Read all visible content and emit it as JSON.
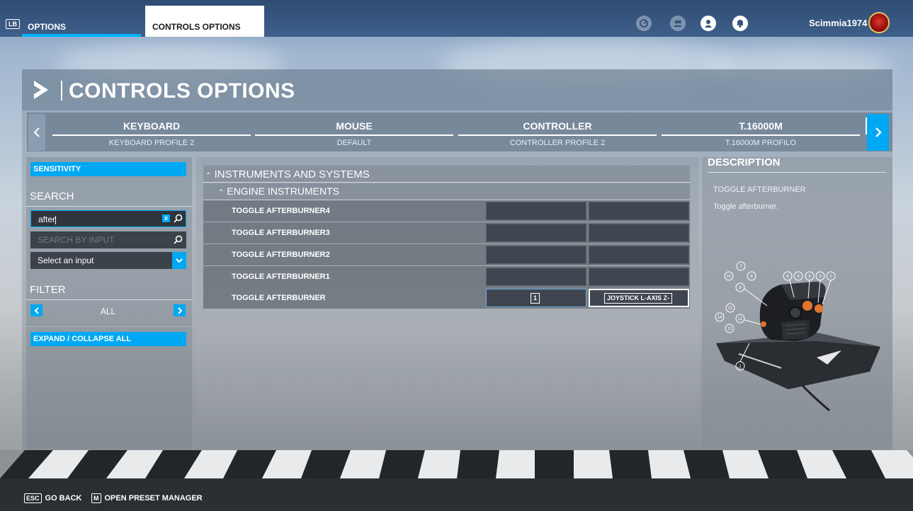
{
  "topbar": {
    "lb_key": "LB",
    "tabs": [
      {
        "label": "OPTIONS"
      },
      {
        "label": "CONTROLS OPTIONS"
      }
    ],
    "username": "Scimmia1974"
  },
  "page": {
    "title": "CONTROLS OPTIONS"
  },
  "devices": [
    {
      "name": "KEYBOARD",
      "profile": "KEYBOARD PROFILE 2"
    },
    {
      "name": "MOUSE",
      "profile": "DEFAULT"
    },
    {
      "name": "CONTROLLER",
      "profile": "CONTROLLER PROFILE 2"
    },
    {
      "name": "T.16000M",
      "profile": "T.16000M PROFILO"
    }
  ],
  "left": {
    "sensitivity_label": "SENSITIVITY",
    "search_title": "SEARCH",
    "search_value": "after",
    "search_clear": "x",
    "search_by_input_placeholder": "SEARCH BY INPUT",
    "select_input_value": "Select an input",
    "filter_title": "FILTER",
    "filter_value": "ALL",
    "expand_collapse_label": "EXPAND / COLLAPSE ALL"
  },
  "bindings": {
    "category": "INSTRUMENTS AND SYSTEMS",
    "subcategory": "ENGINE INSTRUMENTS",
    "rows": [
      {
        "label": "TOGGLE AFTERBURNER4",
        "slot1": "",
        "slot2": ""
      },
      {
        "label": "TOGGLE AFTERBURNER3",
        "slot1": "",
        "slot2": ""
      },
      {
        "label": "TOGGLE AFTERBURNER2",
        "slot1": "",
        "slot2": ""
      },
      {
        "label": "TOGGLE AFTERBURNER1",
        "slot1": "",
        "slot2": ""
      },
      {
        "label": "TOGGLE AFTERBURNER",
        "slot1": "1",
        "slot2": "JOYSTICK L-AXIS Z-"
      }
    ]
  },
  "description": {
    "title": "DESCRIPTION",
    "name": "TOGGLE AFTERBURNER",
    "text": "Toggle afterburner.",
    "button_numbers": [
      "1",
      "2",
      "3",
      "4",
      "5",
      "6",
      "7",
      "8",
      "9",
      "10",
      "11",
      "12",
      "13",
      "14"
    ]
  },
  "bottom": {
    "hints": [
      {
        "key": "ESC",
        "label": "GO BACK"
      },
      {
        "key": "M",
        "label": "OPEN PRESET MANAGER"
      }
    ]
  },
  "colors": {
    "accent": "#00a8f3",
    "topbar": "#34557e",
    "bottombar": "#2b2f33"
  },
  "icons": {
    "top_right": [
      "flight-icon",
      "friends-icon",
      "profile-icon",
      "notifications-icon"
    ]
  }
}
